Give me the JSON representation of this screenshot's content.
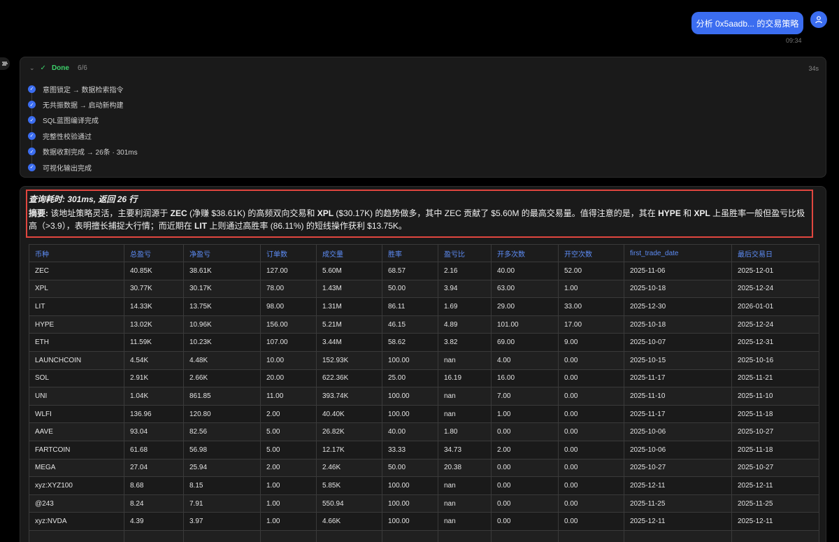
{
  "user_message": {
    "text": "分析 0x5aadb... 的交易策略",
    "time": "09:34"
  },
  "icons": {
    "user": "user-icon",
    "bot": "bot-logo-icon",
    "chevron": "chevron-down-icon",
    "check": "check-icon",
    "step": "check-circle-icon"
  },
  "colors": {
    "accent": "#3b6df0",
    "success": "#3ccf6a",
    "highlight": "#e0463f",
    "header_text": "#5d8cf5"
  },
  "progress": {
    "status": "Done",
    "count": "6/6",
    "elapsed": "34s",
    "steps": [
      {
        "label": "意图锁定 → 数据检索指令"
      },
      {
        "label": "无共振数据 → 启动新构建"
      },
      {
        "label": "SQL蓝图编译完成"
      },
      {
        "label": "完整性校验通过"
      },
      {
        "label": "数据收割完成 → 26条 · 301ms"
      },
      {
        "label": "可视化输出完成"
      }
    ]
  },
  "result": {
    "query_info": "查询耗时: 301ms, 返回 26 行",
    "summary_label": "摘要:",
    "summary_parts": [
      {
        "t": " 该地址策略灵活，主要利润源于 ",
        "b": false
      },
      {
        "t": "ZEC",
        "b": true
      },
      {
        "t": " (净赚 $38.61K) 的高频双向交易和 ",
        "b": false
      },
      {
        "t": "XPL",
        "b": true
      },
      {
        "t": " ($30.17K) 的趋势做多，其中 ZEC 贡献了 $5.60M 的最高交易量。值得注意的是，其在 ",
        "b": false
      },
      {
        "t": "HYPE",
        "b": true
      },
      {
        "t": " 和 ",
        "b": false
      },
      {
        "t": "XPL",
        "b": true
      },
      {
        "t": " 上虽胜率一般但盈亏比极高（>3.9），表明擅长捕捉大行情；而近期在 ",
        "b": false
      },
      {
        "t": "LIT",
        "b": true
      },
      {
        "t": " 上则通过高胜率 (86.11%) 的短线操作获利 $13.75K。",
        "b": false
      }
    ],
    "table": {
      "columns": [
        "币种",
        "总盈亏",
        "净盈亏",
        "订单数",
        "成交量",
        "胜率",
        "盈亏比",
        "开多次数",
        "开空次数",
        "first_trade_date",
        "最后交易日"
      ],
      "rows": [
        [
          "ZEC",
          "40.85K",
          "38.61K",
          "127.00",
          "5.60M",
          "68.57",
          "2.16",
          "40.00",
          "52.00",
          "2025-11-06",
          "2025-12-01"
        ],
        [
          "XPL",
          "30.77K",
          "30.17K",
          "78.00",
          "1.43M",
          "50.00",
          "3.94",
          "63.00",
          "1.00",
          "2025-10-18",
          "2025-12-24"
        ],
        [
          "LIT",
          "14.33K",
          "13.75K",
          "98.00",
          "1.31M",
          "86.11",
          "1.69",
          "29.00",
          "33.00",
          "2025-12-30",
          "2026-01-01"
        ],
        [
          "HYPE",
          "13.02K",
          "10.96K",
          "156.00",
          "5.21M",
          "46.15",
          "4.89",
          "101.00",
          "17.00",
          "2025-10-18",
          "2025-12-24"
        ],
        [
          "ETH",
          "11.59K",
          "10.23K",
          "107.00",
          "3.44M",
          "58.62",
          "3.82",
          "69.00",
          "9.00",
          "2025-10-07",
          "2025-12-31"
        ],
        [
          "LAUNCHCOIN",
          "4.54K",
          "4.48K",
          "10.00",
          "152.93K",
          "100.00",
          "nan",
          "4.00",
          "0.00",
          "2025-10-15",
          "2025-10-16"
        ],
        [
          "SOL",
          "2.91K",
          "2.66K",
          "20.00",
          "622.36K",
          "25.00",
          "16.19",
          "16.00",
          "0.00",
          "2025-11-17",
          "2025-11-21"
        ],
        [
          "UNI",
          "1.04K",
          "861.85",
          "11.00",
          "393.74K",
          "100.00",
          "nan",
          "7.00",
          "0.00",
          "2025-11-10",
          "2025-11-10"
        ],
        [
          "WLFI",
          "136.96",
          "120.80",
          "2.00",
          "40.40K",
          "100.00",
          "nan",
          "1.00",
          "0.00",
          "2025-11-17",
          "2025-11-18"
        ],
        [
          "AAVE",
          "93.04",
          "82.56",
          "5.00",
          "26.82K",
          "40.00",
          "1.80",
          "0.00",
          "0.00",
          "2025-10-06",
          "2025-10-27"
        ],
        [
          "FARTCOIN",
          "61.68",
          "56.98",
          "5.00",
          "12.17K",
          "33.33",
          "34.73",
          "2.00",
          "0.00",
          "2025-10-06",
          "2025-11-18"
        ],
        [
          "MEGA",
          "27.04",
          "25.94",
          "2.00",
          "2.46K",
          "50.00",
          "20.38",
          "0.00",
          "0.00",
          "2025-10-27",
          "2025-10-27"
        ],
        [
          "xyz:XYZ100",
          "8.68",
          "8.15",
          "1.00",
          "5.85K",
          "100.00",
          "nan",
          "0.00",
          "0.00",
          "2025-12-11",
          "2025-12-11"
        ],
        [
          "@243",
          "8.24",
          "7.91",
          "1.00",
          "550.94",
          "100.00",
          "nan",
          "0.00",
          "0.00",
          "2025-11-25",
          "2025-11-25"
        ],
        [
          "xyz:NVDA",
          "4.39",
          "3.97",
          "1.00",
          "4.66K",
          "100.00",
          "nan",
          "0.00",
          "0.00",
          "2025-12-11",
          "2025-12-11"
        ],
        [
          "",
          "",
          "",
          "",
          "",
          "",
          "",
          "",
          "",
          "",
          ""
        ]
      ]
    }
  }
}
